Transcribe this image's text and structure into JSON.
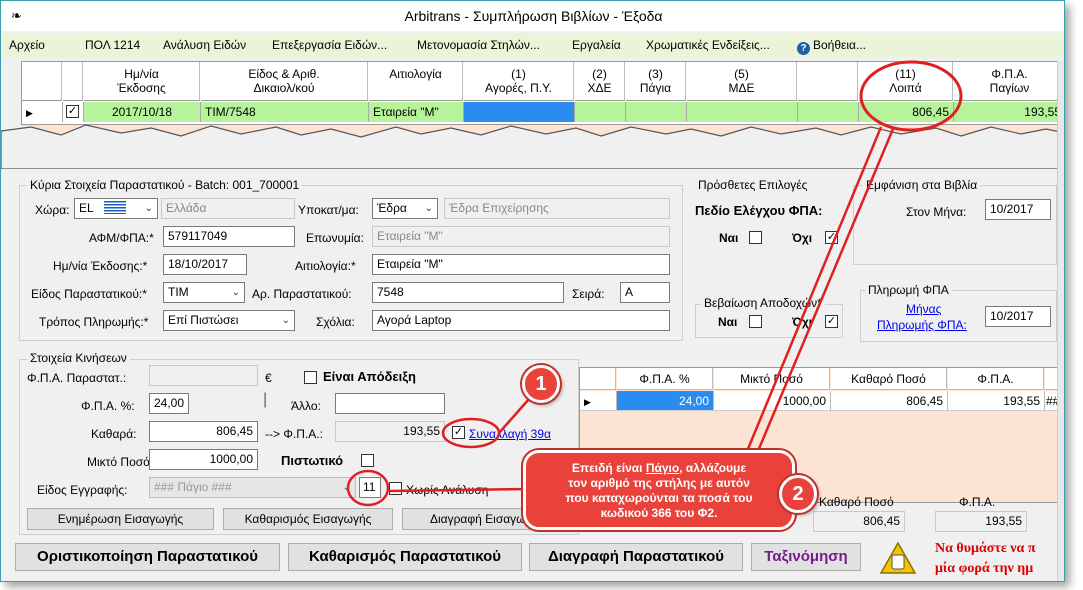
{
  "window": {
    "title": "Arbitrans - Συμπλήρωση Βιβλίων - Έξοδα"
  },
  "menu": [
    "Αρχείο",
    "ΠΟΛ 1214",
    "Ανάλυση Ειδών",
    "Επεξεργασία Ειδών...",
    "Μετονομασία Στηλών...",
    "Εργαλεία",
    "Χρωματικές Ενδείξεις...",
    "Βοήθεια..."
  ],
  "top_grid": {
    "headers": [
      "Ημ/νία\nΈκδοσης",
      "Είδος & Αριθ.\nΔικαιολ/κού",
      "Αιτιολογία",
      "(1)\nΑγορές, Π.Υ.",
      "(2)\nΧΔΕ",
      "(3)\nΠάγια",
      "(5)\nΜΔΕ",
      "(11)\nΛοιπά",
      "Φ.Π.Α.\nΠαγίων"
    ],
    "row": {
      "checked": "✓",
      "date": "2017/10/18",
      "doc": "ΤΙΜ/7548",
      "reason": "Εταιρεία \"Μ\"",
      "loipa": "806,45",
      "fpa_pagion": "193,55"
    }
  },
  "main": {
    "group_title": "Κύρια Στοιχεία Παραστατικού - Batch: 001_700001",
    "labels": {
      "country": "Χώρα:",
      "afm": "ΑΦΜ/ΦΠΑ:*",
      "date": "Ημ/νία Έκδοσης:*",
      "doc_type": "Είδος Παραστατικού:*",
      "payment": "Τρόπος Πληρωμής:*",
      "branch": "Υποκατ/μα:",
      "name": "Επωνυμία:",
      "reason": "Αιτιολογία:*",
      "doc_no": "Αρ. Παραστατικού:",
      "series": "Σειρά:",
      "notes": "Σχόλια:"
    },
    "values": {
      "country_code": "EL",
      "country_name": "Ελλάδα",
      "afm": "579117049",
      "date": "18/10/2017",
      "doc_type": "ΤΙΜ",
      "payment": "Επί Πιστώσει",
      "branch": "Έδρα",
      "branch_name": "Έδρα Επιχείρησης",
      "name": "Εταιρεία \"Μ\"",
      "reason": "Εταιρεία \"Μ\"",
      "doc_no": "7548",
      "series": "A",
      "notes": "Αγορά Laptop"
    }
  },
  "extra": {
    "title": "Πρόσθετες Επιλογές",
    "vat_check": "Πεδίο Ελέγχου ΦΠΑ:",
    "yes": "Ναι",
    "no": "Όχι",
    "receipt_cert": "Βεβαίωση Αποδοχών*",
    "yes2": "Ναι",
    "no2": "Όχι"
  },
  "books": {
    "title": "Εμφάνιση στα Βιβλία",
    "month_label": "Στον Μήνα:",
    "month": "10/2017",
    "vat_pay_title": "Πληρωμή ΦΠΑ",
    "vat_pay_link1": "Μήνας",
    "vat_pay_link2": "Πληρωμής ΦΠΑ:",
    "vat_month": "10/2017"
  },
  "moves": {
    "title": "Στοιχεία Κινήσεων",
    "fpa_doc_label": "Φ.Π.Α. Παραστατ.:",
    "euro": "€",
    "is_receipt": "Είναι Απόδειξη",
    "fpa_pct_label": "Φ.Π.Α. %:",
    "fpa_pct": "24,00",
    "allo_label": "Άλλο:",
    "net_label": "Καθαρά:",
    "net": "806,45",
    "arrow_fpa_label": "--> Φ.Π.Α.:",
    "arrow_fpa": "193,55",
    "synallagi": "Συναλλαγή 39α",
    "gross_label": "Μικτό Ποσό:",
    "gross": "1000,00",
    "credit_label": "Πιστωτικό",
    "entry_type_label": "Είδος Εγγραφής:",
    "entry_type": "### Πάγιο ###",
    "entry_col": "11",
    "no_analysis": "Χωρίς Ανάλυση",
    "btn_update": "Ενημέρωση Εισαγωγής",
    "btn_clear": "Καθαρισμός Εισαγωγής",
    "btn_delete": "Διαγραφή Εισαγωγής"
  },
  "mini_grid": {
    "headers": [
      "Φ.Π.Α. %",
      "Μικτό Ποσό",
      "Καθαρό Ποσό",
      "Φ.Π.Α."
    ],
    "row": [
      "24,00",
      "1000,00",
      "806,45",
      "193,55",
      "###"
    ],
    "tot_net_label": "Καθαρό Ποσό",
    "tot_fpa_label": "Φ.Π.Α.",
    "tot_net": "806,45",
    "tot_fpa": "193,55"
  },
  "bottom": {
    "finalize": "Οριστικοποίηση Παραστατικού",
    "clear": "Καθαρισμός Παραστατικού",
    "delete": "Διαγραφή Παραστατικού",
    "sort": "Ταξινόμηση",
    "reminder1": "Να θυμάστε να π",
    "reminder2": "μία φορά την ημ"
  },
  "callout": {
    "n1": "1",
    "n2": "2",
    "line1a": "Επειδή είναι ",
    "line1b": "Πάγιο",
    "line1c": ", αλλάζουμε",
    "line2": "τον αριθμό της στήλης με αυτόν",
    "line3": "που καταχωρούνται τα ποσά του",
    "line4": "κωδικού 366 του Φ2."
  },
  "colors": {
    "row_green": "#b6f39b",
    "selected_blue": "#2b8cf0",
    "callout_red": "#e8423b",
    "menu_bg": "#eaf4d8"
  }
}
